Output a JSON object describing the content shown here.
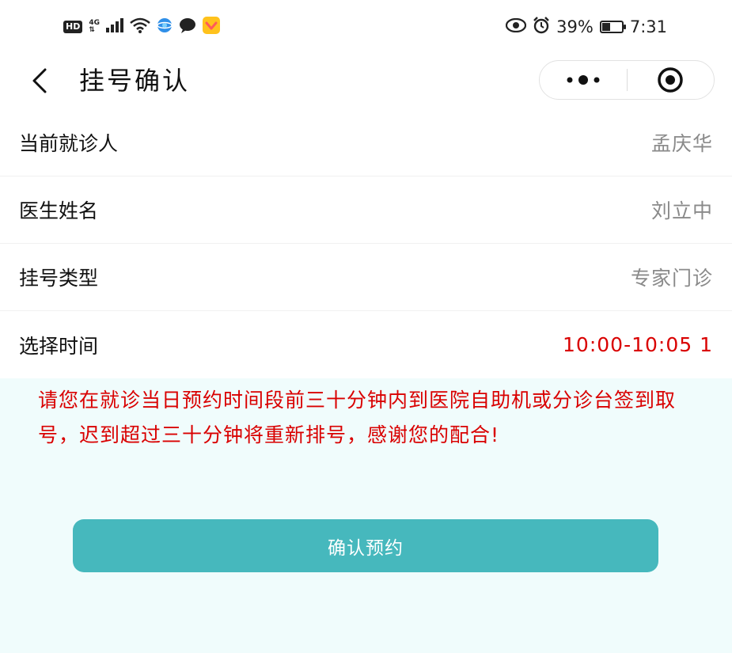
{
  "status_bar": {
    "hd": "HD",
    "network": "4G",
    "battery": "39%",
    "battery_level": 0.39,
    "time": "7:31",
    "icons": [
      "signal-icon",
      "wifi-icon",
      "browser-icon",
      "message-icon",
      "app-icon",
      "eye-icon",
      "alarm-icon",
      "battery-icon"
    ]
  },
  "nav": {
    "title": "挂号确认"
  },
  "rows": [
    {
      "label": "当前就诊人",
      "value": "孟庆华"
    },
    {
      "label": "医生姓名",
      "value": "刘立中"
    },
    {
      "label": "挂号类型",
      "value": "专家门诊"
    },
    {
      "label": "选择时间",
      "value": "10:00-10:05 1"
    }
  ],
  "notice": "请您在就诊当日预约时间段前三十分钟内到医院自助机或分诊台签到取号，迟到超过三十分钟将重新排号，感谢您的配合!",
  "confirm_label": "确认预约",
  "colors": {
    "accent": "#46b8bd",
    "warning": "#d90000",
    "notice_bg": "#f0fcfc"
  }
}
